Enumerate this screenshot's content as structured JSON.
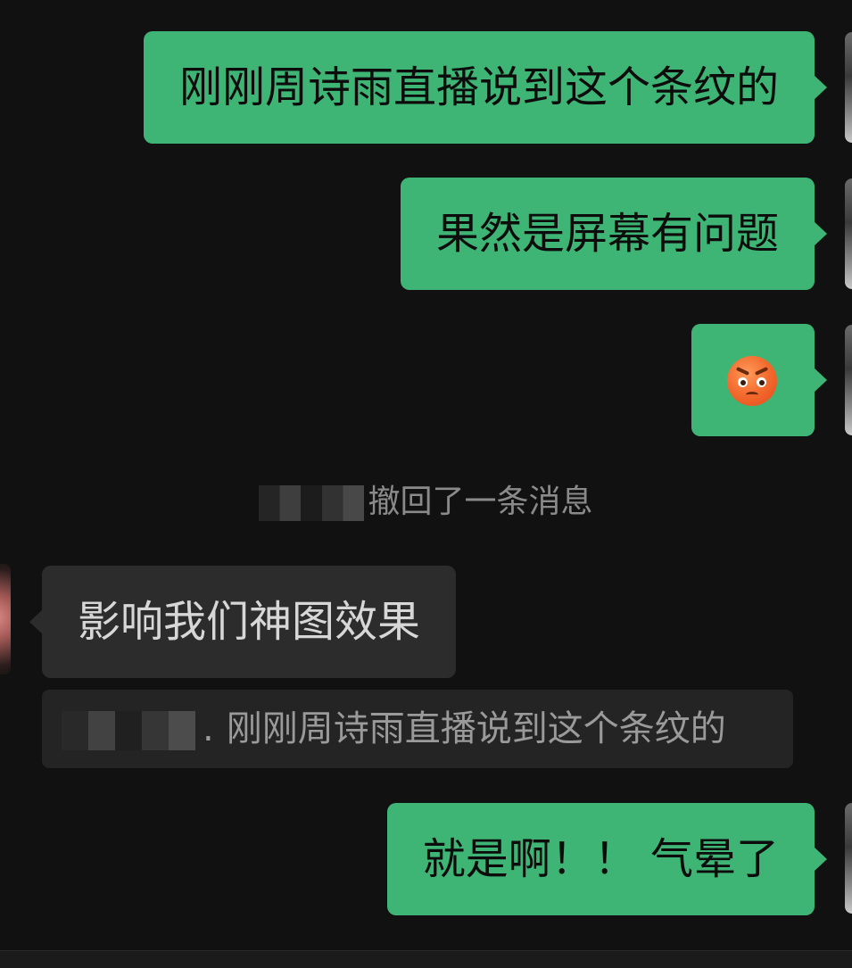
{
  "messages": [
    {
      "direction": "out",
      "text": "刚刚周诗雨直播说到这个条纹的"
    },
    {
      "direction": "out",
      "text": "果然是屏幕有问题"
    },
    {
      "direction": "out",
      "emoji": "angry-face"
    },
    {
      "direction": "in",
      "text": "影响我们神图效果"
    },
    {
      "direction": "out",
      "text": "就是啊！！ 气晕了"
    }
  ],
  "recall_notice": "撤回了一条消息",
  "quote": {
    "separator": ".",
    "text": "刚刚周诗雨直播说到这个条纹的"
  },
  "colors": {
    "background": "#111111",
    "outgoing_bubble": "#3eb575",
    "incoming_bubble": "#2c2c2c",
    "quote_bg": "#242424"
  }
}
